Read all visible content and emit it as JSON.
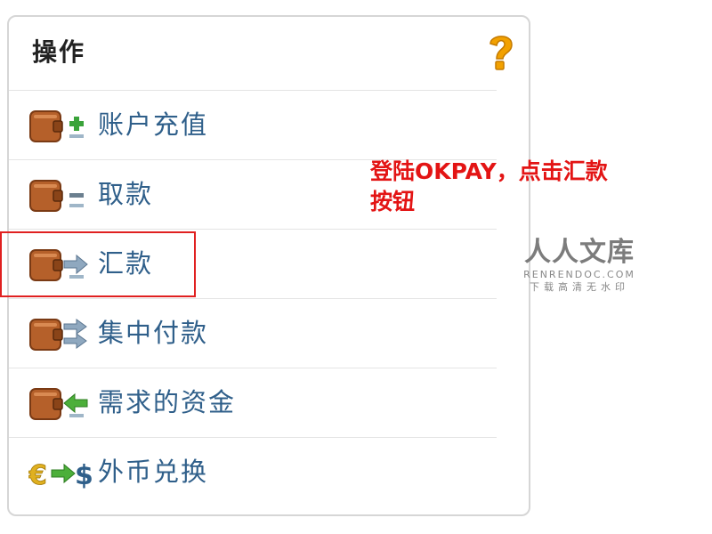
{
  "panel": {
    "title": "操作"
  },
  "menu": {
    "items": [
      {
        "label": "账户充值",
        "icon": "wallet-plus-icon"
      },
      {
        "label": "取款",
        "icon": "wallet-minus-icon"
      },
      {
        "label": "汇款",
        "icon": "wallet-send-icon"
      },
      {
        "label": "集中付款",
        "icon": "wallet-mass-pay-icon"
      },
      {
        "label": "需求的资金",
        "icon": "wallet-request-icon"
      },
      {
        "label": "外币兑换",
        "icon": "currency-exchange-icon"
      }
    ]
  },
  "annotation": {
    "text_line1": "登陆OKPAY，点击汇款",
    "text_line2": "按钮"
  },
  "watermark": {
    "main": "人人文库",
    "domain": "RENRENDOC.COM",
    "sub": "下载高清无水印"
  },
  "colors": {
    "label_blue": "#2f5f8a",
    "highlight_red": "#e02020",
    "annotation_red": "#e31414",
    "wallet_brown": "#b5602a",
    "help_orange": "#f2a100"
  }
}
